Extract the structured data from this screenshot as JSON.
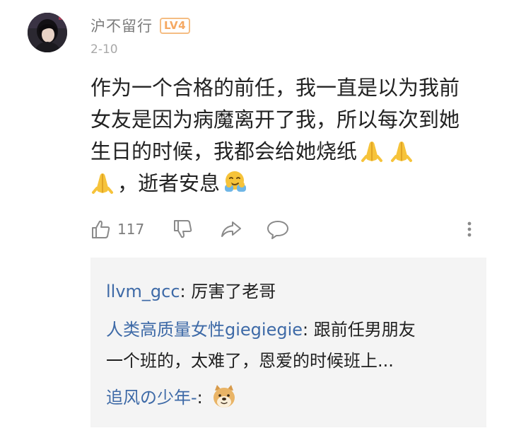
{
  "comment": {
    "username": "沪不留行",
    "level_badge": "LV4",
    "date": "2-10",
    "body_lines": [
      "作为一个合格的前任，我一直是以为我前",
      "女友是因为病魔离开了我，所以每次到她",
      "生日的时候，我都会给她烧纸",
      "，逝者安息"
    ],
    "like_count": "117"
  },
  "icons": {
    "avatar": "user-avatar-photo",
    "prayer": "folded-hands-emoji",
    "hug": "hugging-face-emoji",
    "like": "thumbs-up-icon",
    "dislike": "thumbs-down-icon",
    "share": "share-arrow-icon",
    "reply": "speech-bubble-icon",
    "more": "vertical-dots-icon",
    "doge": "doge-emoji"
  },
  "replies": [
    {
      "name": "llvm_gcc",
      "sep": ": ",
      "text": "厉害了老哥"
    },
    {
      "name": "人类高质量女性giegiegie",
      "sep": ": ",
      "text": "跟前任男朋友",
      "continuation": "一个班的，太难了，恩爱的时候班上..."
    },
    {
      "name": "追风の少年-",
      "sep": ": ",
      "text": ""
    }
  ],
  "colors": {
    "reply_name": "#3e6aa7",
    "body_text": "#222222",
    "meta_text": "#a8a8a8",
    "badge": "#f5a862",
    "reply_bg": "#f4f4f4"
  }
}
